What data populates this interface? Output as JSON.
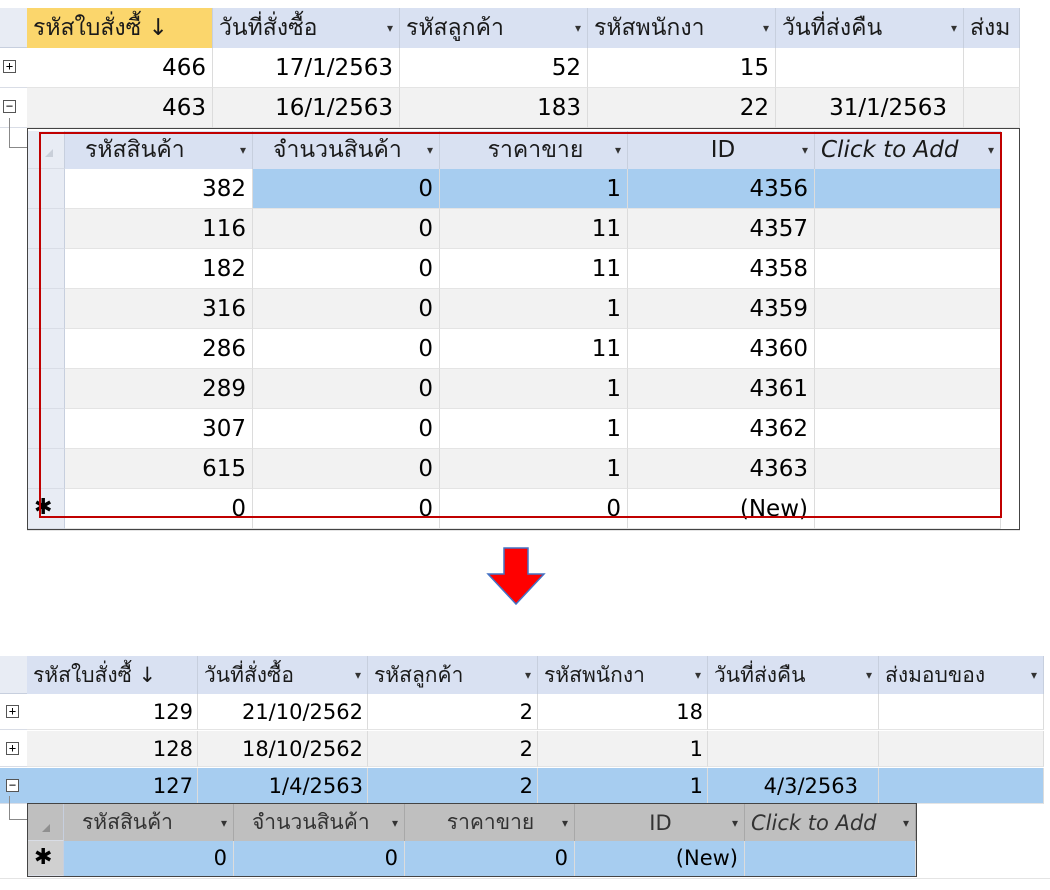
{
  "top": {
    "headers": [
      "รหัสใบสั่งซื้ ↓",
      "วันที่สั่งซื้อ",
      "รหัสลูกค้า",
      "รหัสพนักงา",
      "วันที่ส่งคืน",
      "ส่งม"
    ],
    "dropdown_glyph": "▾",
    "rows": [
      {
        "expander": "+",
        "cells": [
          "466",
          "17/1/2563",
          "52",
          "15",
          ""
        ]
      },
      {
        "expander": "−",
        "cells": [
          "463",
          "16/1/2563",
          "183",
          "22",
          "31/1/2563"
        ]
      }
    ],
    "sub_headers": [
      "รหัสสินค้า",
      "จำนวนสินค้า",
      "ราคาขาย",
      "ID",
      "Click to Add"
    ],
    "sub_rows": [
      [
        "382",
        "0",
        "1",
        "4356",
        ""
      ],
      [
        "116",
        "0",
        "11",
        "4357",
        ""
      ],
      [
        "182",
        "0",
        "11",
        "4358",
        ""
      ],
      [
        "316",
        "0",
        "1",
        "4359",
        ""
      ],
      [
        "286",
        "0",
        "11",
        "4360",
        ""
      ],
      [
        "289",
        "0",
        "1",
        "4361",
        ""
      ],
      [
        "307",
        "0",
        "1",
        "4362",
        ""
      ],
      [
        "615",
        "0",
        "1",
        "4363",
        ""
      ]
    ],
    "new_row": {
      "marker": "✱",
      "cells": [
        "0",
        "0",
        "0",
        "(New)",
        ""
      ]
    }
  },
  "bottom": {
    "headers": [
      "รหัสใบสั่งซื้ ↓",
      "วันที่สั่งซื้อ",
      "รหัสลูกค้า",
      "รหัสพนักงา",
      "วันที่ส่งคืน",
      "ส่งมอบของ"
    ],
    "rows": [
      {
        "expander": "+",
        "cells": [
          "129",
          "21/10/2562",
          "2",
          "18",
          "",
          ""
        ]
      },
      {
        "expander": "+",
        "cells": [
          "128",
          "18/10/2562",
          "2",
          "1",
          "",
          ""
        ]
      },
      {
        "expander": "−",
        "cells": [
          "127",
          "1/4/2563",
          "2",
          "1",
          "4/3/2563",
          ""
        ]
      }
    ],
    "sub_headers": [
      "รหัสสินค้า",
      "จำนวนสินค้า",
      "ราคาขาย",
      "ID",
      "Click to Add"
    ],
    "new_row": {
      "marker": "✱",
      "cells": [
        "0",
        "0",
        "0",
        "(New)",
        ""
      ]
    }
  },
  "colors": {
    "header_bg": "#d9e1f2",
    "sorted_header_bg": "#fbd66c",
    "selected_row_bg": "#a7cdf0",
    "alt_row_bg": "#f2f2f2",
    "highlight_box": "#c00000",
    "arrow_fill": "#ff0000",
    "arrow_stroke": "#4472c4"
  }
}
